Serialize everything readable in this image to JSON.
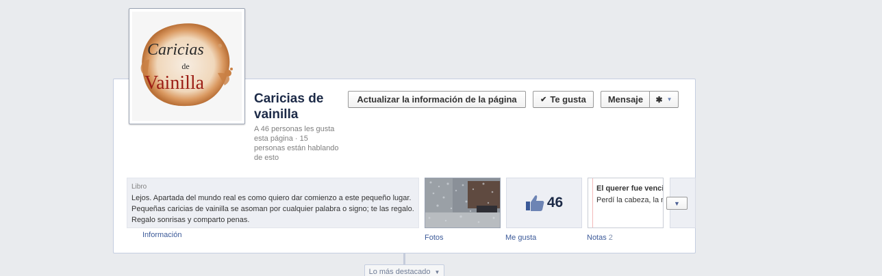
{
  "page": {
    "name": "Caricias de vainilla",
    "stats": "A 46 personas les gusta esta página · 15 personas están hablando de esto"
  },
  "logo": {
    "line1": "Caricias",
    "line2": "de",
    "line3": "Vainilla"
  },
  "actions": {
    "update_label": "Actualizar la información de la página",
    "like_label": "Te gusta",
    "like_check": "✔",
    "message_label": "Mensaje",
    "gear_icon": "gear-icon",
    "caret": "▼"
  },
  "about": {
    "category": "Libro",
    "description": "Lejos. Apartada del mundo real es como quiero dar comienzo a este pequeño lugar. Pequeñas caricias de vainilla se asoman por cualquier palabra o signo; te las regalo. Regalo sonrisas y comparto penas."
  },
  "tabs": {
    "info_label": "Información",
    "photos_label": "Fotos",
    "likes_label": "Me gusta",
    "likes_count": "46",
    "notes_label": "Notas",
    "notes_count": "2"
  },
  "note_preview": {
    "title": "El querer fue vencido en batalla, en un",
    "body": "Perdí la cabeza, la más los zapatos en alguna"
  },
  "timeline": {
    "highlights_label": "Lo más destacado"
  },
  "colors": {
    "background": "#e9ebee",
    "link": "#3b5998",
    "title": "#1c2a47"
  }
}
